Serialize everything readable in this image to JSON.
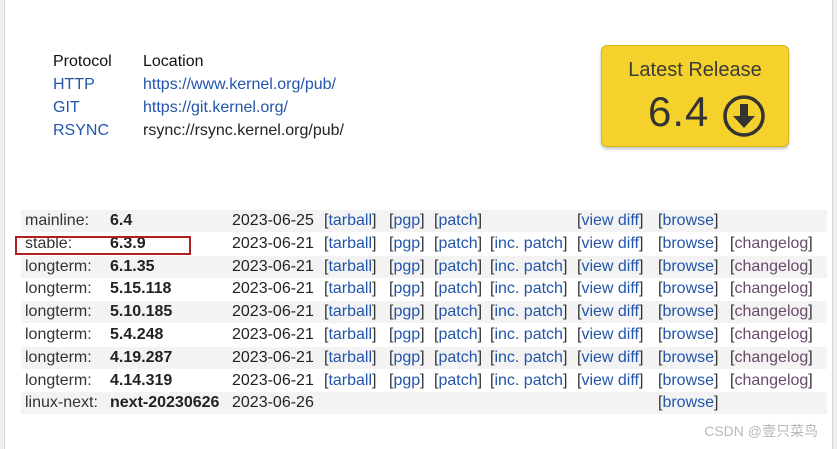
{
  "protocols": {
    "headers": {
      "protocol": "Protocol",
      "location": "Location"
    },
    "rows": [
      {
        "protocol": "HTTP",
        "location": "https://www.kernel.org/pub/",
        "proto_link": true,
        "loc_link": true
      },
      {
        "protocol": "GIT",
        "location": "https://git.kernel.org/",
        "proto_link": true,
        "loc_link": true
      },
      {
        "protocol": "RSYNC",
        "location": "rsync://rsync.kernel.org/pub/",
        "proto_link": true,
        "loc_link": false
      }
    ]
  },
  "latest_release": {
    "title": "Latest Release",
    "version": "6.4",
    "icon": "download-arrow-icon",
    "color": "#f5d22b"
  },
  "releases": [
    {
      "kind": "mainline:",
      "version": "6.4",
      "date": "2023-06-25",
      "tarball": "tarball",
      "pgp": "pgp",
      "patch": "patch",
      "inc_patch": "",
      "view_diff": "view diff",
      "browse": "browse",
      "changelog": ""
    },
    {
      "kind": "stable:",
      "version": "6.3.9",
      "date": "2023-06-21",
      "tarball": "tarball",
      "pgp": "pgp",
      "patch": "patch",
      "inc_patch": "inc. patch",
      "view_diff": "view diff",
      "browse": "browse",
      "changelog": "changelog"
    },
    {
      "kind": "longterm:",
      "version": "6.1.35",
      "date": "2023-06-21",
      "tarball": "tarball",
      "pgp": "pgp",
      "patch": "patch",
      "inc_patch": "inc. patch",
      "view_diff": "view diff",
      "browse": "browse",
      "changelog": "changelog"
    },
    {
      "kind": "longterm:",
      "version": "5.15.118",
      "date": "2023-06-21",
      "tarball": "tarball",
      "pgp": "pgp",
      "patch": "patch",
      "inc_patch": "inc. patch",
      "view_diff": "view diff",
      "browse": "browse",
      "changelog": "changelog"
    },
    {
      "kind": "longterm:",
      "version": "5.10.185",
      "date": "2023-06-21",
      "tarball": "tarball",
      "pgp": "pgp",
      "patch": "patch",
      "inc_patch": "inc. patch",
      "view_diff": "view diff",
      "browse": "browse",
      "changelog": "changelog"
    },
    {
      "kind": "longterm:",
      "version": "5.4.248",
      "date": "2023-06-21",
      "tarball": "tarball",
      "pgp": "pgp",
      "patch": "patch",
      "inc_patch": "inc. patch",
      "view_diff": "view diff",
      "browse": "browse",
      "changelog": "changelog"
    },
    {
      "kind": "longterm:",
      "version": "4.19.287",
      "date": "2023-06-21",
      "tarball": "tarball",
      "pgp": "pgp",
      "patch": "patch",
      "inc_patch": "inc. patch",
      "view_diff": "view diff",
      "browse": "browse",
      "changelog": "changelog"
    },
    {
      "kind": "longterm:",
      "version": "4.14.319",
      "date": "2023-06-21",
      "tarball": "tarball",
      "pgp": "pgp",
      "patch": "patch",
      "inc_patch": "inc. patch",
      "view_diff": "view diff",
      "browse": "browse",
      "changelog": "changelog"
    },
    {
      "kind": "linux-next:",
      "version": "next-20230626",
      "date": "2023-06-26",
      "tarball": "",
      "pgp": "",
      "patch": "",
      "inc_patch": "",
      "view_diff": "",
      "browse": "browse",
      "changelog": ""
    }
  ],
  "highlight_color": "#b02020",
  "watermark": "CSDN @壹只菜鸟"
}
